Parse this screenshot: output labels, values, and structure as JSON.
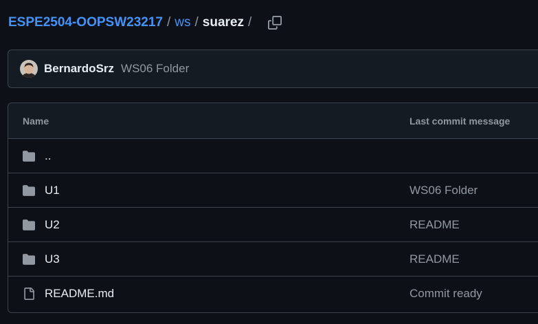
{
  "breadcrumb": {
    "repo": "ESPE2504-OOPSW23217",
    "sep1": "/",
    "dir1": "ws",
    "sep2": "/",
    "current": "suarez",
    "sep3": "/"
  },
  "icons": {
    "copy": "copy-icon",
    "folder": "folder-icon",
    "file": "file-icon"
  },
  "latest_commit": {
    "author": "BernardoSrz",
    "message": "WS06 Folder"
  },
  "table": {
    "headers": {
      "name": "Name",
      "last_commit": "Last commit message"
    },
    "rows": [
      {
        "type": "folder",
        "name": "..",
        "message": ""
      },
      {
        "type": "folder",
        "name": "U1",
        "message": "WS06 Folder"
      },
      {
        "type": "folder",
        "name": "U2",
        "message": "README"
      },
      {
        "type": "folder",
        "name": "U3",
        "message": "README"
      },
      {
        "type": "file",
        "name": "README.md",
        "message": "Commit ready"
      }
    ]
  },
  "colors": {
    "background": "#0d1117",
    "link": "#4493f8",
    "muted": "#9198a1",
    "border": "#3d444d"
  }
}
